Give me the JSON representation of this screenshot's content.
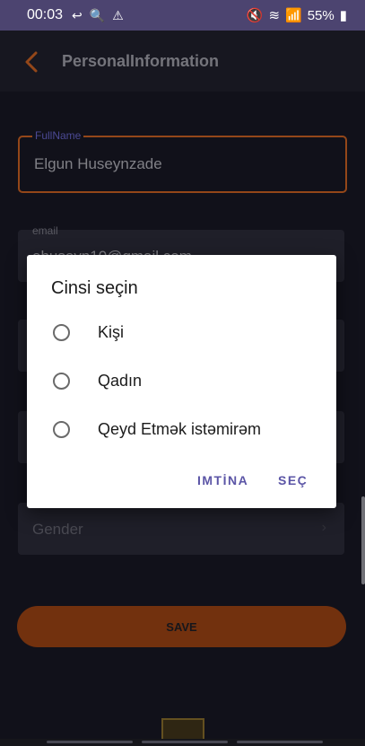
{
  "status_bar": {
    "time": "00:03",
    "left_icons": [
      "missed-call-icon",
      "search-icon",
      "warning-icon"
    ],
    "right_icons": [
      "mute-icon",
      "wifi-icon",
      "signal-icon"
    ],
    "battery_percent": "55%"
  },
  "header": {
    "title": "PersonalInformation"
  },
  "form": {
    "fullname": {
      "label": "FullName",
      "value": "Elgun Huseynzade"
    },
    "email": {
      "label": "email",
      "value": "ehuseyn10@gmail.com"
    },
    "gender": {
      "placeholder": "Gender"
    }
  },
  "save_button": {
    "label": "SAVE"
  },
  "dialog": {
    "title": "Cinsi seçin",
    "options": [
      {
        "label": "Kişi"
      },
      {
        "label": "Qadın"
      },
      {
        "label": "Qeyd Etmək istəmirəm"
      }
    ],
    "cancel_label": "IMTİNA",
    "confirm_label": "SEÇ"
  },
  "colors": {
    "accent": "#b5571f",
    "status_bar": "#4c4470",
    "dialog_action": "#5b55a6"
  }
}
